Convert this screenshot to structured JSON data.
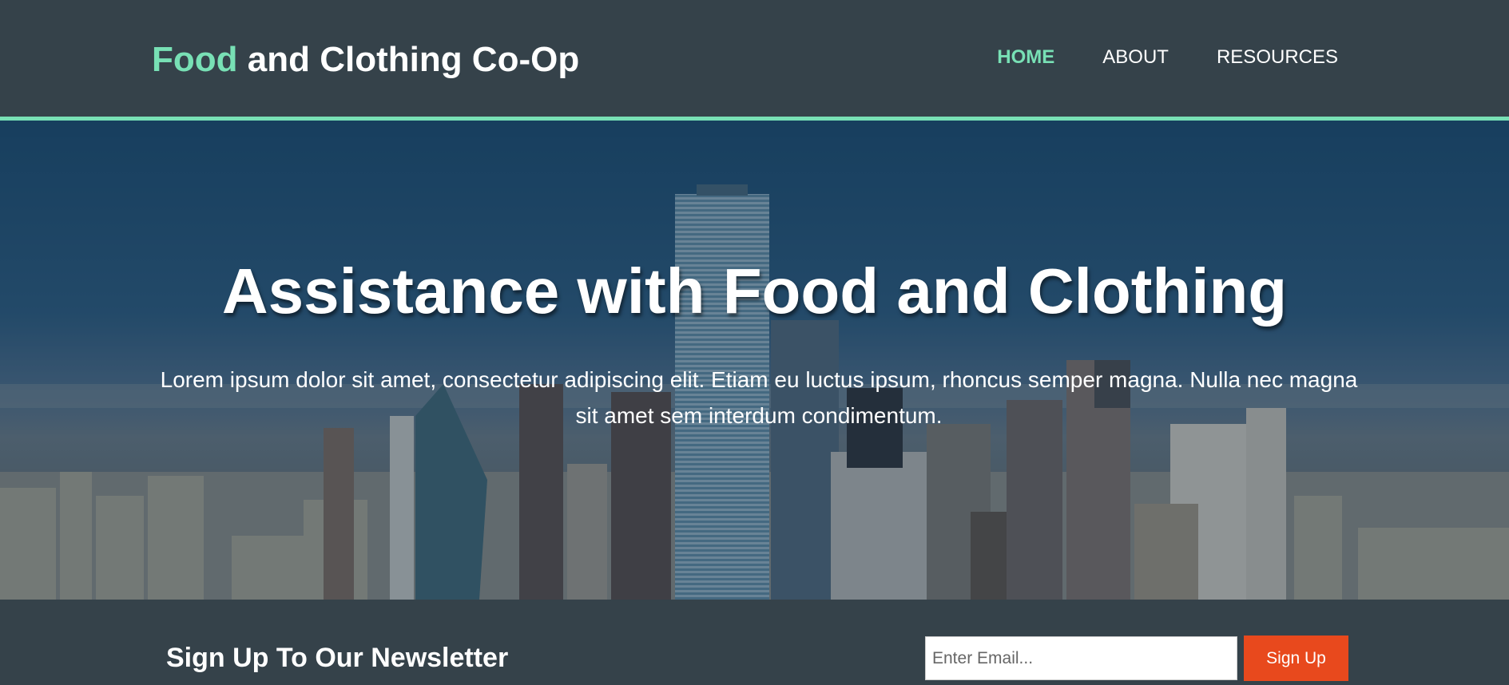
{
  "header": {
    "brand_highlight": "Food",
    "brand_rest": " and Clothing Co-Op",
    "nav": [
      {
        "label": "HOME",
        "active": true
      },
      {
        "label": "ABOUT",
        "active": false
      },
      {
        "label": "RESOURCES",
        "active": false
      }
    ]
  },
  "hero": {
    "title": "Assistance with Food and Clothing",
    "text": "Lorem ipsum dolor sit amet, consectetur adipiscing elit. Etiam eu luctus ipsum, rhoncus semper magna. Nulla nec magna sit amet sem interdum condimentum."
  },
  "newsletter": {
    "title": "Sign Up To Our Newsletter",
    "email_placeholder": "Enter Email...",
    "email_value": "",
    "button_label": "Sign Up"
  },
  "colors": {
    "background": "#35424a",
    "accent": "#78e0b5",
    "button": "#e8491d"
  }
}
